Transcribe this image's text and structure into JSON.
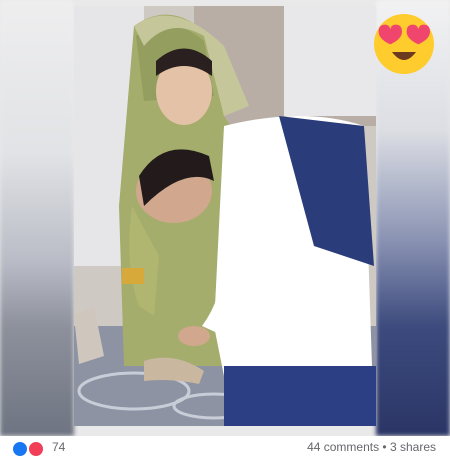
{
  "post": {
    "reaction_count": "74",
    "comments_shares": "44 comments • 3 shares"
  },
  "icons": {
    "emoji": "heart-eyes-emoji-icon",
    "reaction_1": "like-reaction-icon",
    "reaction_2": "love-reaction-icon"
  },
  "colors": {
    "like_blue": "#1877f2",
    "love_red": "#f33e58",
    "text_gray": "#65676b"
  }
}
